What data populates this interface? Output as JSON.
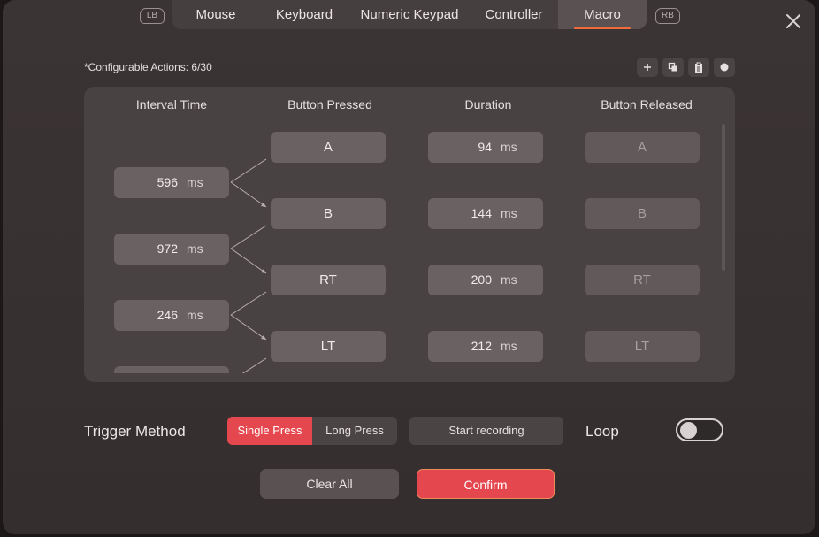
{
  "tabs": [
    {
      "label": "Mouse",
      "active": false
    },
    {
      "label": "Keyboard",
      "active": false
    },
    {
      "label": "Numeric Keypad",
      "active": false
    },
    {
      "label": "Controller",
      "active": false
    },
    {
      "label": "Macro",
      "active": true
    }
  ],
  "bumpers": {
    "left": "LB",
    "right": "RB"
  },
  "counter": "*Configurable Actions: 6/30",
  "toolbar_icons": [
    "add-icon",
    "copy-icon",
    "paste-icon",
    "record-dot-icon"
  ],
  "columns": {
    "interval": "Interval Time",
    "pressed": "Button Pressed",
    "duration": "Duration",
    "released": "Button Released"
  },
  "unit": "ms",
  "actions": [
    {
      "pressed": "A",
      "duration": "94",
      "released": "A"
    },
    {
      "pressed": "B",
      "duration": "144",
      "released": "B"
    },
    {
      "pressed": "RT",
      "duration": "200",
      "released": "RT"
    },
    {
      "pressed": "LT",
      "duration": "212",
      "released": "LT"
    }
  ],
  "intervals": [
    "596",
    "972",
    "246",
    ""
  ],
  "trigger": {
    "label": "Trigger Method",
    "options": [
      "Single Press",
      "Long Press"
    ],
    "selected": "Single Press"
  },
  "start_recording": "Start recording",
  "loop": {
    "label": "Loop",
    "enabled": false
  },
  "buttons": {
    "clear": "Clear All",
    "confirm": "Confirm"
  },
  "colors": {
    "accent": "#e5474f",
    "tab_underline": "#f06a3c"
  }
}
